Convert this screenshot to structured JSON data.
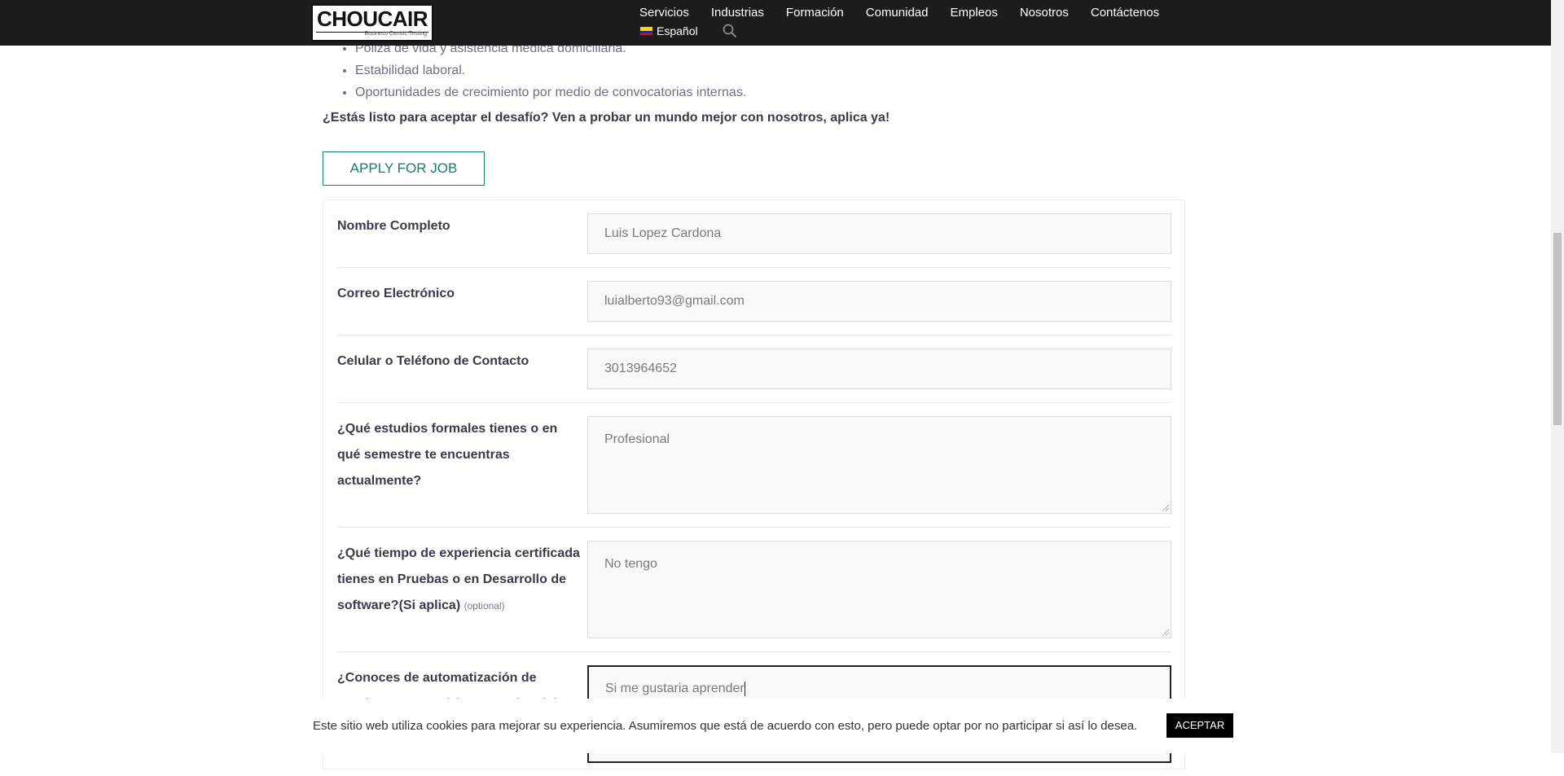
{
  "header": {
    "logo_text": "CHOUCAIR",
    "logo_tagline": "Business Centric Testing",
    "nav": [
      "Servicios",
      "Industrias",
      "Formación",
      "Comunidad",
      "Empleos",
      "Nosotros",
      "Contáctenos"
    ],
    "language": "Español"
  },
  "benefits": [
    "Póliza de vida y asistencia médica domiciliaria.",
    "Estabilidad laboral.",
    "Oportunidades de crecimiento por medio de convocatorias internas."
  ],
  "cta_text": "¿Estás listo para aceptar el desafío? Ven a probar un mundo mejor con nosotros, aplica ya!",
  "apply_button": "APPLY FOR JOB",
  "form": {
    "full_name": {
      "label": "Nombre Completo",
      "value": "Luis Lopez Cardona"
    },
    "email": {
      "label": "Correo Electrónico",
      "value": "luialberto93@gmail.com"
    },
    "phone": {
      "label": "Celular o Teléfono de Contacto",
      "value": "3013964652"
    },
    "studies": {
      "label": "¿Qué estudios formales tienes o en qué semestre te encuentras actualmente?",
      "value": "Profesional"
    },
    "experience": {
      "label": "¿Qué tiempo de experiencia certificada tienes en Pruebas o en Desarrollo de software?(Si aplica)",
      "optional": "(optional)",
      "value": "No tengo"
    },
    "automation": {
      "label": "¿Conoces de automatización de pruebas? ¿Tu podrías aprender?(Si aplica)",
      "value": "Si me gustaria aprender"
    }
  },
  "cookie": {
    "text": "Este sitio web utiliza cookies para mejorar su experiencia. Asumiremos que está de acuerdo con esto, pero puede optar por no participar si así lo desea.",
    "button": "ACEPTAR"
  }
}
